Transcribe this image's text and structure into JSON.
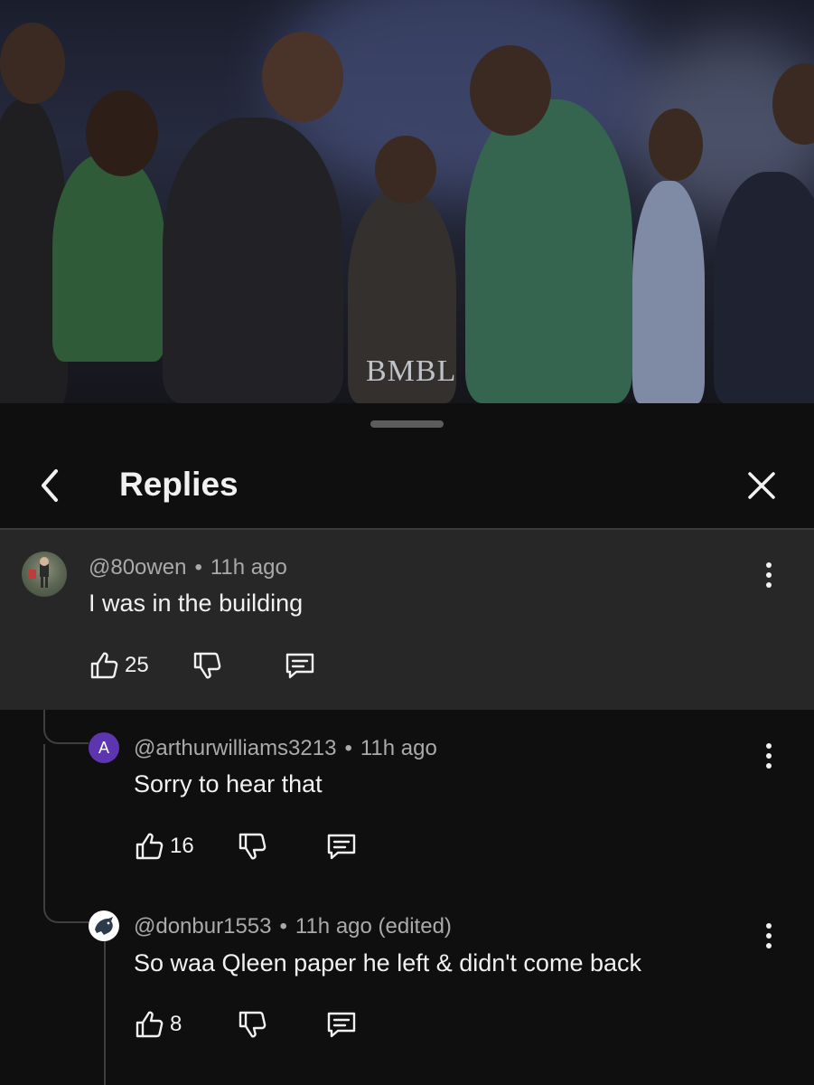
{
  "video": {
    "watermark": "BMBL"
  },
  "sheet": {
    "title": "Replies",
    "back_icon": "chevron-left-icon",
    "close_icon": "close-icon"
  },
  "comments": [
    {
      "author": "@80owen",
      "time": "11h ago",
      "text": "I was in the building",
      "likes": "25",
      "avatar": "photo"
    },
    {
      "author": "@arthurwilliams3213",
      "time": "11h ago",
      "text": "Sorry to hear that",
      "likes": "16",
      "avatar_letter": "A",
      "avatar_color": "#5e35b1"
    },
    {
      "author": "@donbur1553",
      "time": "11h ago (edited)",
      "text": "So waa Qleen paper he left & didn't come back",
      "likes": "8",
      "avatar": "lion-logo"
    }
  ],
  "colors": {
    "background": "#0f0f0f",
    "highlight": "#272727",
    "meta_text": "#aaaaaa",
    "text": "#f1f1f1"
  }
}
